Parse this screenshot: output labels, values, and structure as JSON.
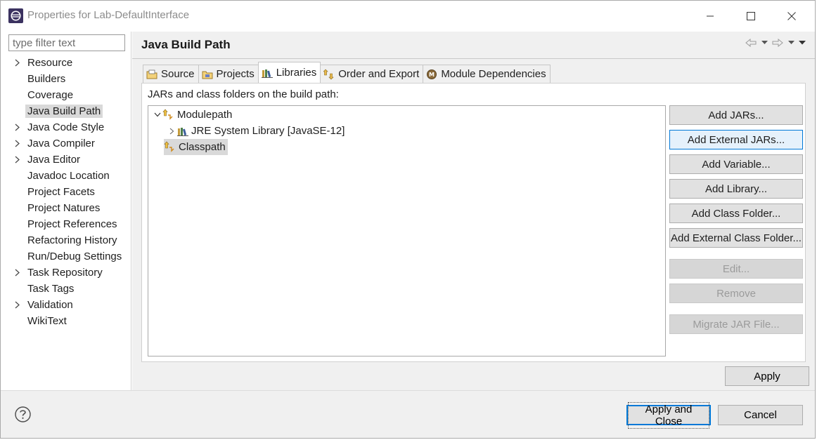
{
  "window": {
    "title": "Properties for Lab-DefaultInterface",
    "app_icon": "eclipse-icon"
  },
  "filter": {
    "placeholder": "type filter text",
    "value": ""
  },
  "nav": {
    "items": [
      {
        "label": "Resource",
        "expandable": true
      },
      {
        "label": "Builders",
        "expandable": false
      },
      {
        "label": "Coverage",
        "expandable": false
      },
      {
        "label": "Java Build Path",
        "expandable": false,
        "selected": true
      },
      {
        "label": "Java Code Style",
        "expandable": true
      },
      {
        "label": "Java Compiler",
        "expandable": true
      },
      {
        "label": "Java Editor",
        "expandable": true
      },
      {
        "label": "Javadoc Location",
        "expandable": false
      },
      {
        "label": "Project Facets",
        "expandable": false
      },
      {
        "label": "Project Natures",
        "expandable": false
      },
      {
        "label": "Project References",
        "expandable": false
      },
      {
        "label": "Refactoring History",
        "expandable": false
      },
      {
        "label": "Run/Debug Settings",
        "expandable": false
      },
      {
        "label": "Task Repository",
        "expandable": true
      },
      {
        "label": "Task Tags",
        "expandable": false
      },
      {
        "label": "Validation",
        "expandable": true
      },
      {
        "label": "WikiText",
        "expandable": false
      }
    ]
  },
  "page": {
    "heading": "Java Build Path"
  },
  "tabs": [
    {
      "label": "Source",
      "icon": "source-folder-icon"
    },
    {
      "label": "Projects",
      "icon": "projects-icon"
    },
    {
      "label": "Libraries",
      "icon": "libraries-icon",
      "active": true
    },
    {
      "label": "Order and Export",
      "icon": "order-export-icon"
    },
    {
      "label": "Module Dependencies",
      "icon": "module-icon"
    }
  ],
  "libraries": {
    "label": "JARs and class folders on the build path:",
    "tree": [
      {
        "label": "Modulepath",
        "icon": "modulepath-icon",
        "expanded": true
      },
      {
        "label": "JRE System Library [JavaSE-12]",
        "icon": "jre-library-icon",
        "expanded": false
      },
      {
        "label": "Classpath",
        "icon": "classpath-icon",
        "selected": true
      }
    ]
  },
  "buttons": {
    "add_jars": "Add JARs...",
    "add_external_jars": "Add External JARs...",
    "add_variable": "Add Variable...",
    "add_library": "Add Library...",
    "add_class_folder": "Add Class Folder...",
    "add_external_class_folder": "Add External Class Folder...",
    "edit": "Edit...",
    "remove": "Remove",
    "migrate_jar": "Migrate JAR File...",
    "apply": "Apply",
    "apply_and_close": "Apply and Close",
    "cancel": "Cancel"
  },
  "colors": {
    "accent": "#0078d7",
    "hover_bg": "#e5f1fb",
    "selection_bg": "#d9d9d9",
    "panel_bg": "#f0f0f0"
  }
}
